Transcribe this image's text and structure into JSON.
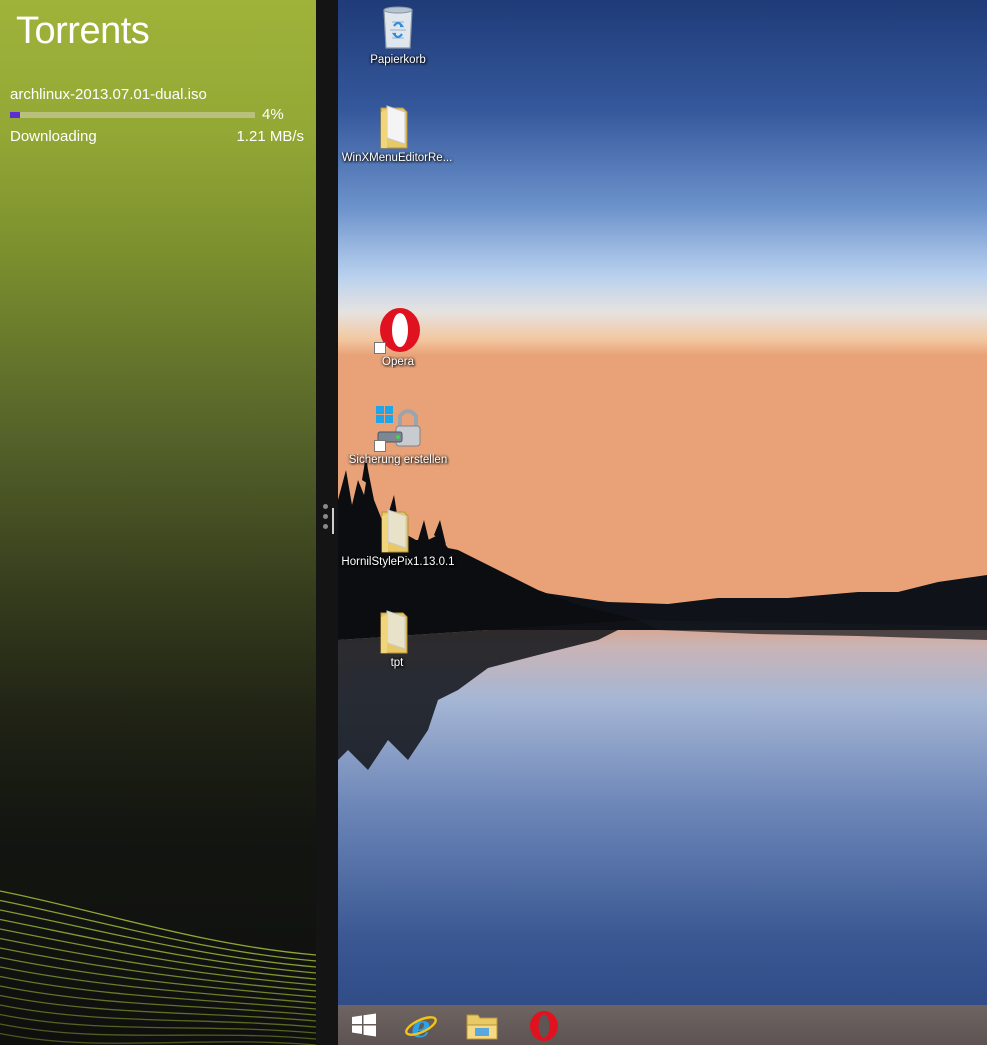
{
  "app": {
    "title": "Torrents",
    "torrent": {
      "name": "archlinux-2013.07.01-dual.iso",
      "progress_percent": 4,
      "progress_label": "4%",
      "status": "Downloading",
      "speed": "1.21 MB/s"
    }
  },
  "desktop": {
    "icons": [
      {
        "label": "Papierkorb",
        "icon": "recycle-bin-icon"
      },
      {
        "label": "WinXMenuEditorRe...",
        "icon": "folder-icon"
      },
      {
        "label": "Opera",
        "icon": "opera-icon"
      },
      {
        "label": "Sicherung erstellen",
        "icon": "backup-lock-icon"
      },
      {
        "label": "HornilStylePix1.13.0.1",
        "icon": "folder-icon"
      },
      {
        "label": "tpt",
        "icon": "folder-icon"
      }
    ]
  },
  "taskbar": {
    "items": [
      {
        "icon": "windows-start-icon"
      },
      {
        "icon": "internet-explorer-icon"
      },
      {
        "icon": "file-explorer-icon"
      },
      {
        "icon": "opera-icon"
      }
    ]
  },
  "colors": {
    "progress_fill": "#5b2fd0",
    "app_accent": "#9fb33a",
    "opera_red": "#e0121f",
    "taskbar": "#665c5a"
  }
}
